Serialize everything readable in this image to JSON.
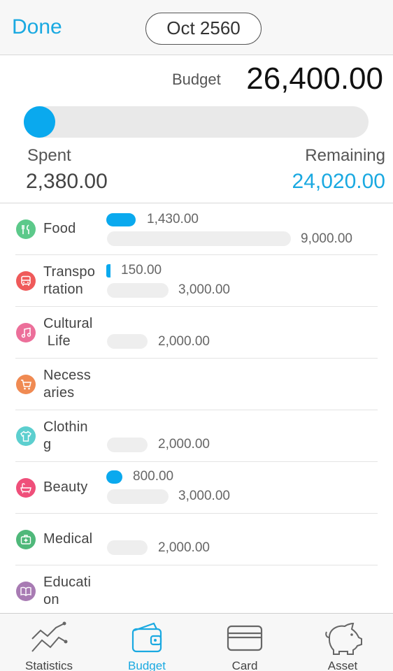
{
  "header": {
    "done_label": "Done",
    "month": "Oct 2560"
  },
  "summary": {
    "budget_label": "Budget",
    "budget_value": "26,400.00",
    "spent_label": "Spent",
    "spent_value": "2,380.00",
    "remaining_label": "Remaining",
    "remaining_value": "24,020.00",
    "spent_fraction": 0.09
  },
  "categories": [
    {
      "name": "Food",
      "icon": "fork-knife-icon",
      "color": "#5cc98a",
      "spent": "1,430.00",
      "budget": "9,000.00",
      "fraction": 0.159
    },
    {
      "name": "Transpo\nrtation",
      "icon": "bus-icon",
      "color": "#ef5a5a",
      "spent": "150.00",
      "budget": "3,000.00",
      "fraction": 0.05
    },
    {
      "name": "Cultural\n Life",
      "icon": "music-note-icon",
      "color": "#ec6f9a",
      "spent": "",
      "budget": "2,000.00",
      "fraction": 0
    },
    {
      "name": "Necess\naries",
      "icon": "shopping-cart-icon",
      "color": "#f08a52",
      "spent": "",
      "budget": "",
      "fraction": 0
    },
    {
      "name": "Clothin\ng",
      "icon": "shirt-icon",
      "color": "#5ccfcf",
      "spent": "",
      "budget": "2,000.00",
      "fraction": 0
    },
    {
      "name": "Beauty",
      "icon": "bathtub-icon",
      "color": "#ef4f7a",
      "spent": "800.00",
      "budget": "3,000.00",
      "fraction": 0.267
    },
    {
      "name": "Medical",
      "icon": "first-aid-kit-icon",
      "color": "#4fb87a",
      "spent": "",
      "budget": "2,000.00",
      "fraction": 0
    },
    {
      "name": "Educati\non",
      "icon": "book-icon",
      "color": "#a87bb3",
      "spent": "",
      "budget": "",
      "fraction": 0
    }
  ],
  "tabs": [
    {
      "label": "Statistics",
      "icon": "chart-line-icon",
      "active": false
    },
    {
      "label": "Budget",
      "icon": "wallet-icon",
      "active": true
    },
    {
      "label": "Card",
      "icon": "credit-card-icon",
      "active": false
    },
    {
      "label": "Asset",
      "icon": "piggy-bank-icon",
      "active": false
    }
  ],
  "colors": {
    "accent": "#1aa9e1",
    "bar": "#0aa9ee",
    "track": "#eeeeee"
  }
}
